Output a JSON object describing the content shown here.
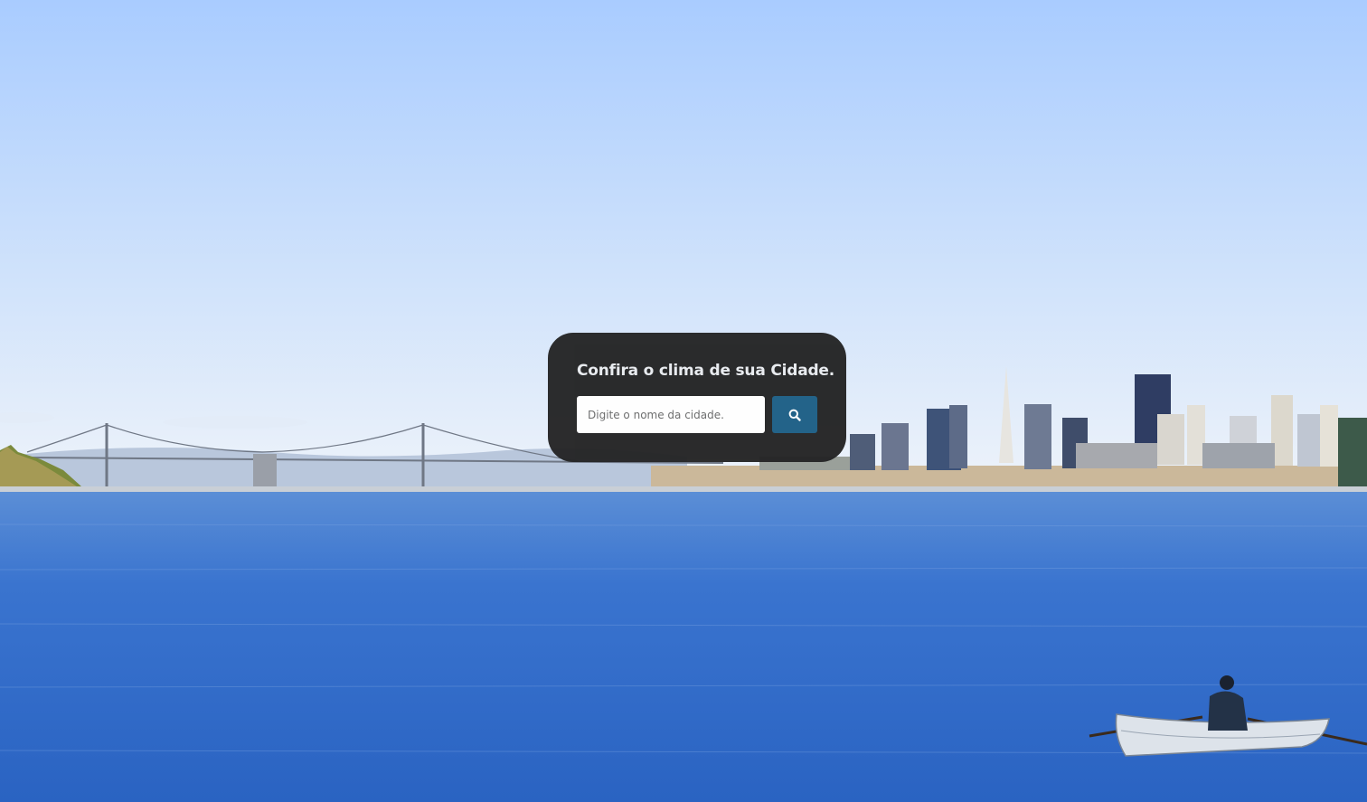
{
  "colors": {
    "card_background": "#252526",
    "search_button": "#1d5f86",
    "title_text": "#e9ecef"
  },
  "widget": {
    "title": "Confira o clima de sua Cidade.",
    "input": {
      "placeholder": "Digite o nome da cidade.",
      "value": ""
    },
    "button": {
      "icon": "search-icon"
    }
  },
  "background": {
    "scene": "san-francisco-bay-skyline"
  }
}
